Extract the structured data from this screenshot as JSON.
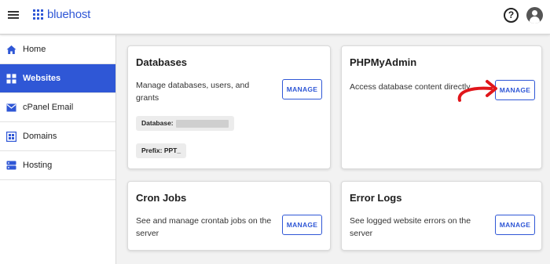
{
  "header": {
    "brand": "bluehost",
    "help_glyph": "?",
    "icons": [
      "menu-icon",
      "help-icon",
      "account-icon"
    ]
  },
  "sidebar": {
    "items": [
      {
        "label": "Home",
        "icon": "home-icon",
        "active": false
      },
      {
        "label": "Websites",
        "icon": "websites-icon",
        "active": true
      },
      {
        "label": "cPanel Email",
        "icon": "email-icon",
        "active": false
      },
      {
        "label": "Domains",
        "icon": "domains-icon",
        "active": false
      },
      {
        "label": "Hosting",
        "icon": "hosting-icon",
        "active": false
      }
    ]
  },
  "cards": {
    "databases": {
      "title": "Databases",
      "description": "Manage databases, users, and grants",
      "button": "MANAGE",
      "database_label": "Database:",
      "prefix_label": "Prefix: PPT_"
    },
    "phpmyadmin": {
      "title": "PHPMyAdmin",
      "description": "Access database content directly",
      "button": "MANAGE"
    },
    "cron_jobs": {
      "title": "Cron Jobs",
      "description": "See and manage crontab jobs on the server",
      "button": "MANAGE"
    },
    "error_logs": {
      "title": "Error Logs",
      "description": "See logged website errors on the server",
      "button": "MANAGE"
    }
  },
  "colors": {
    "accent": "#2f57d6",
    "annotation_arrow": "#e0161b"
  }
}
